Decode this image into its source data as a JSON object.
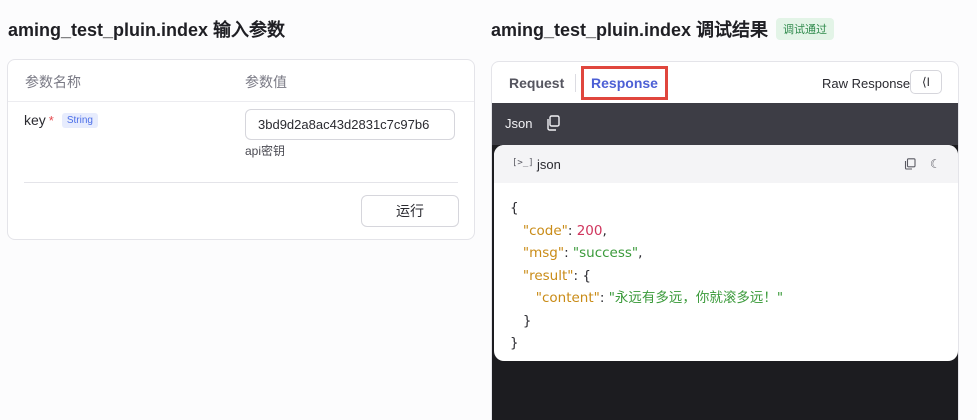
{
  "left_panel": {
    "title": "aming_test_pluin.index 输入参数",
    "headers": {
      "name": "参数名称",
      "value": "参数值"
    },
    "param": {
      "key": "key",
      "required_mark": "*",
      "type": "String",
      "value": "3bd9d2a8ac43d2831c7c97b6",
      "description": "api密钥"
    },
    "run_label": "运行"
  },
  "right_panel": {
    "title": "aming_test_pluin.index 调试结果",
    "badge": "调试通过",
    "tabs": {
      "request": "Request",
      "response": "Response"
    },
    "raw_label": "Raw Response",
    "collapse_glyph": "⟨I",
    "format_label": "Json",
    "code_card": {
      "terminal_glyph": "[>_]",
      "lang": "json"
    }
  },
  "json_result": {
    "code_key": "\"code\"",
    "code_value": "200",
    "msg_key": "\"msg\"",
    "msg_value": "\"success\"",
    "result_key": "\"result\"",
    "content_key": "\"content\"",
    "content_value": "\"永远有多远，你就滚多远！\""
  },
  "colors": {
    "accent": "#4c5fd5",
    "highlight_box": "#e0463d",
    "json_key": "#c98b16",
    "json_string": "#3a9a3a",
    "json_number": "#d0355d",
    "badge_text": "#2f8a4c",
    "badge_bg": "#e3f4e7"
  },
  "icons": [
    "copy-icon",
    "terminal-icon",
    "moon-icon",
    "collapse-panel-icon"
  ]
}
